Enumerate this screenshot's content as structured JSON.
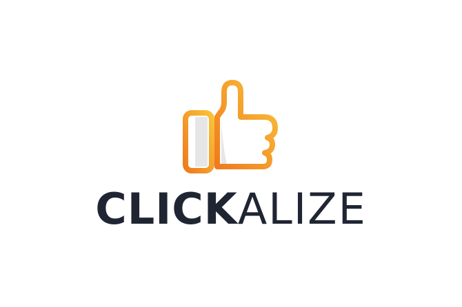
{
  "brand": {
    "name_bold": "CLICK",
    "name_light": "ALIZE",
    "icon": "thumbs-up-icon"
  },
  "colors": {
    "background": "#ffffff",
    "wordmark": "#1f2532",
    "gradient_start": "#f9c33b",
    "gradient_end": "#f07a1d",
    "icon_fill": "#ffffff",
    "icon_shade": "#e6e6e6"
  }
}
